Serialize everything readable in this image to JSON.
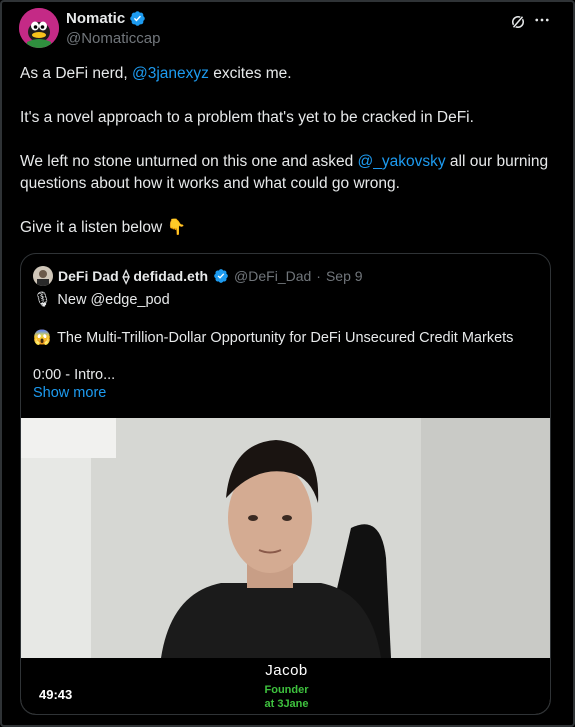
{
  "author": {
    "name": "Nomatic",
    "handle": "@Nomaticcap"
  },
  "header_icons": [
    "verified-badge-icon",
    "grok-icon",
    "more-icon"
  ],
  "tweet": {
    "p1_before": "As a DeFi nerd, ",
    "p1_mention": "@3janexyz",
    "p1_after": " excites me.",
    "p2": "It's a novel approach to a problem that's yet to be cracked in DeFi.",
    "p3_before": "We left no stone unturned on this one and asked ",
    "p3_mention": "@_yakovsky",
    "p3_after": " all our burning questions about how it works and what could go wrong.",
    "p4": "Give it a listen below",
    "p4_emoji": "👇"
  },
  "quote": {
    "name": "DeFi Dad ⟠ defidad.eth",
    "handle": "@DeFi_Dad",
    "separator": "·",
    "date": "Sep 9",
    "line1_emoji": "🎙",
    "line1": "New @edge_pod",
    "line2_emoji": "😱",
    "line2": "The Multi-Trillion-Dollar Opportunity for DeFi Unsecured Credit Markets",
    "line3": "0:00 - Intro...",
    "show_more": "Show more"
  },
  "video": {
    "caption_name": "Jacob",
    "caption_role_1": "Founder",
    "caption_role_2": "at 3Jane",
    "duration": "49:43"
  },
  "colors": {
    "background": "#000000",
    "text": "#e7e9ea",
    "secondary": "#71767b",
    "link": "#1d9bf0",
    "border": "#2f3336",
    "caption_green": "#3ec13e"
  }
}
